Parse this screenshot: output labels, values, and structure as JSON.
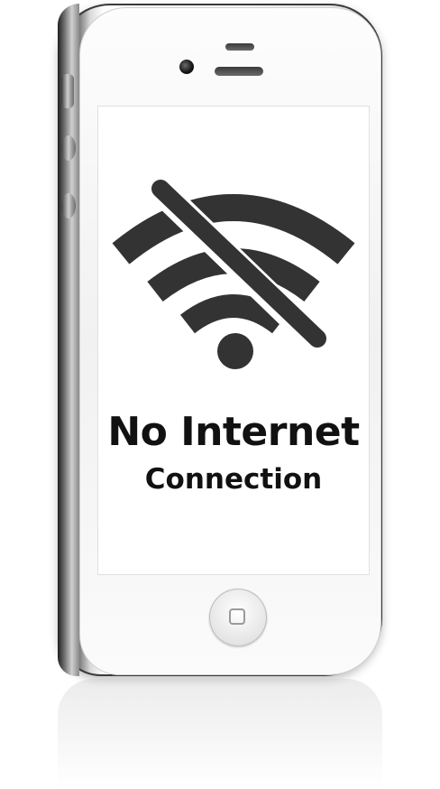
{
  "screen": {
    "status_icon": "wifi-off-icon",
    "headline": "No Internet",
    "subline": "Connection"
  },
  "device": {
    "type": "phone",
    "home_button_icon": "home-square-icon"
  },
  "colors": {
    "icon": "#333333",
    "text": "#111111",
    "screen_background": "#ffffff"
  }
}
